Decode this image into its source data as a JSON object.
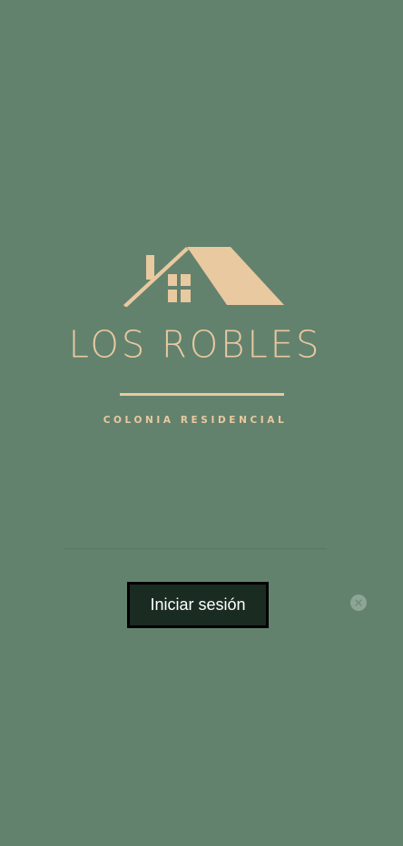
{
  "colors": {
    "background": "#62826e",
    "accent": "#e9c9a0",
    "button_background": "#1a2b22",
    "button_border": "#000000"
  },
  "logo": {
    "icon": "house-icon",
    "name": "LOS ROBLES",
    "tagline": "COLONIA RESIDENCIAL"
  },
  "login_button": {
    "label": "Iniciar sesión"
  },
  "close_button": {
    "icon": "close-icon"
  }
}
